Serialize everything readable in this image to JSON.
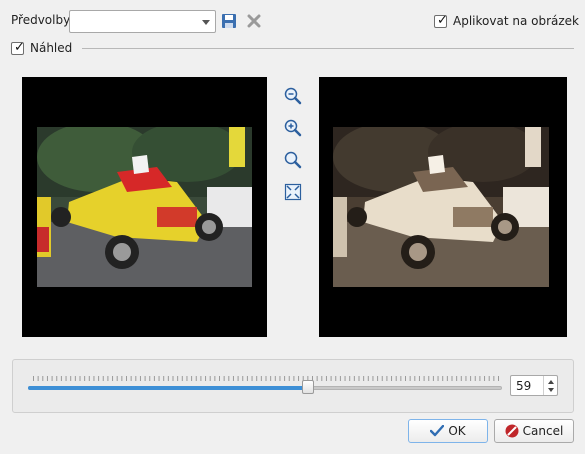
{
  "toolbar": {
    "presets_label": "Předvolby:",
    "presets_value": "",
    "apply_label": "Aplikovat na obrázek",
    "apply_checked": true
  },
  "preview": {
    "label": "Náhled",
    "checked": true
  },
  "zoom_tools": [
    "zoom-out-icon",
    "zoom-in-icon",
    "zoom-actual-size-icon",
    "zoom-fit-icon"
  ],
  "slider": {
    "value": "59",
    "min": 0,
    "max": 100
  },
  "buttons": {
    "ok": "OK",
    "cancel": "Cancel"
  },
  "colors": {
    "accent": "#3d8fd6",
    "ok_icon": "#2f6db3",
    "cancel_icon": "#c0262a"
  }
}
